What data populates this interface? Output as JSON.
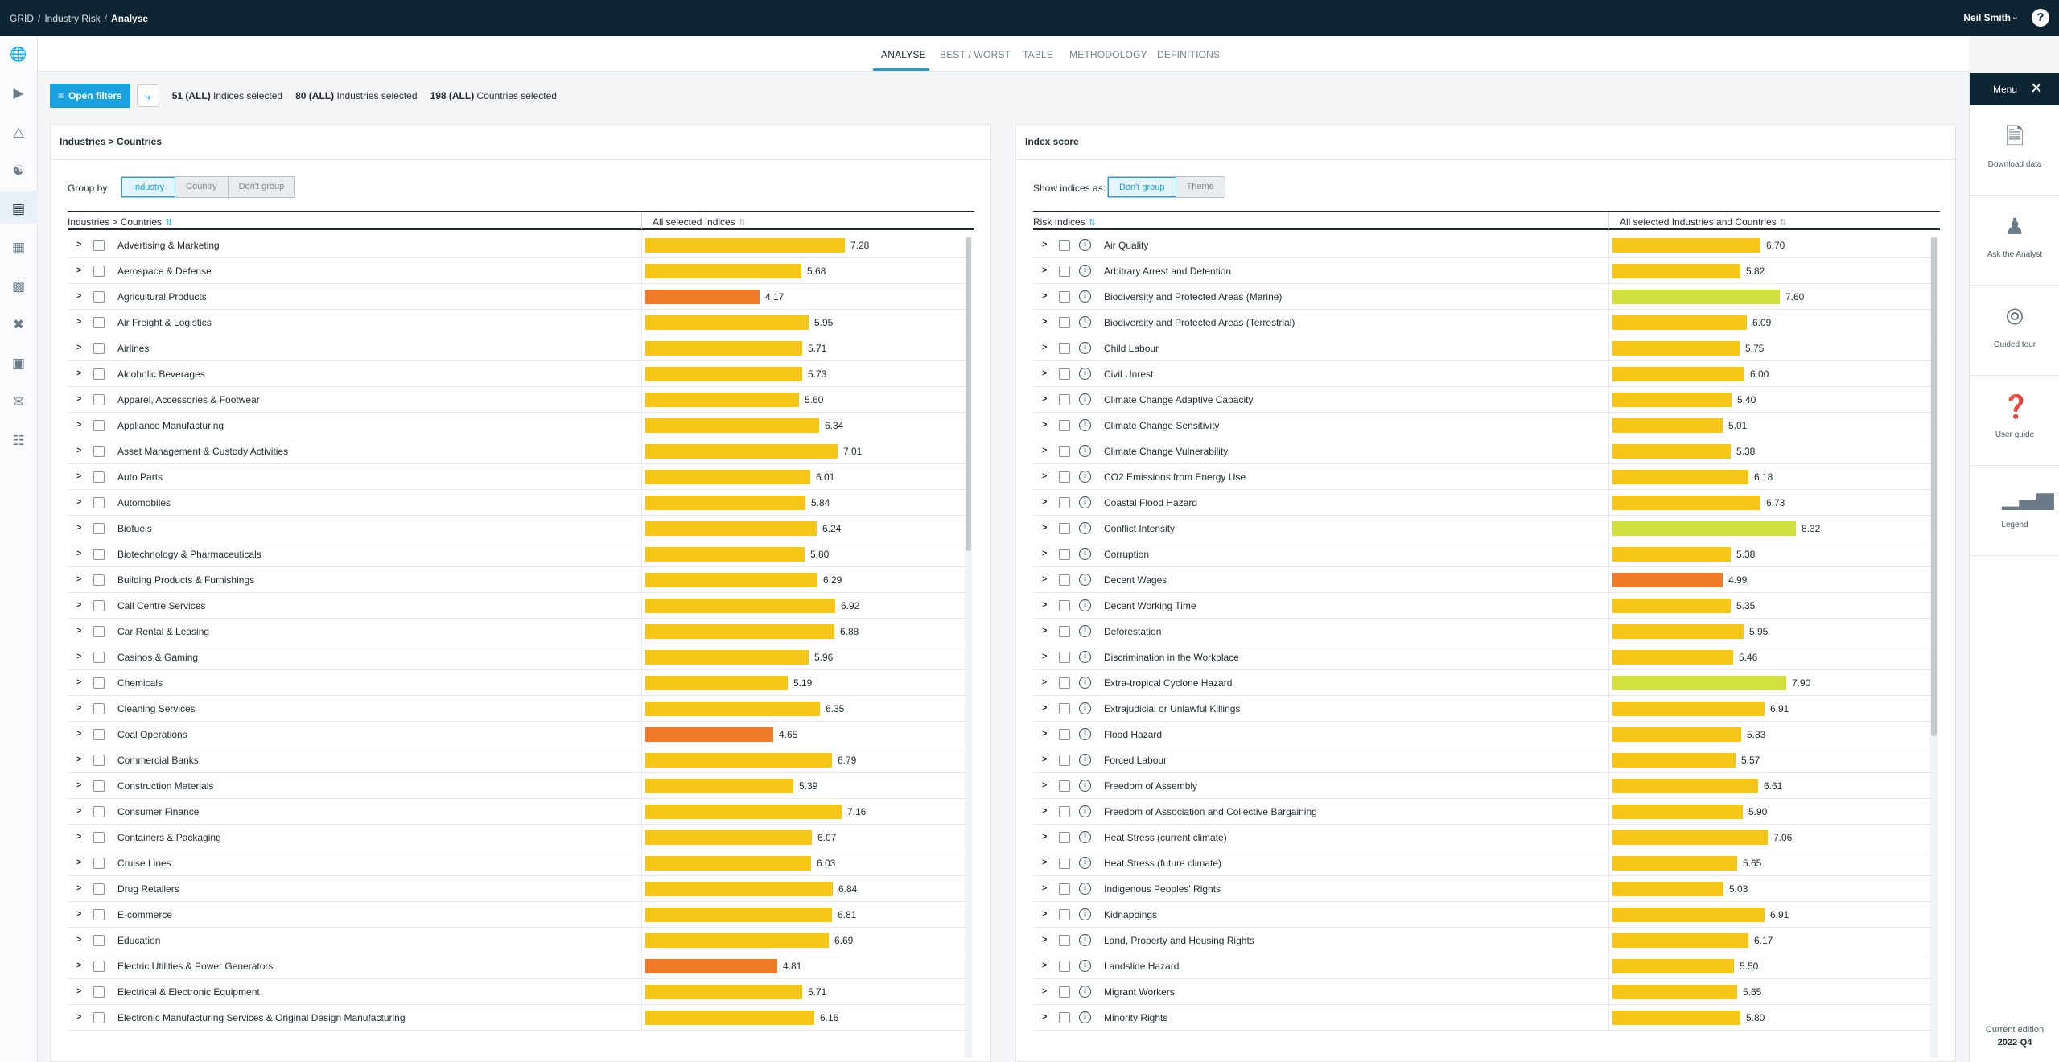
{
  "breadcrumb": [
    "GRID",
    "Industry Risk",
    "Analyse"
  ],
  "user": {
    "name": "Neil Smith"
  },
  "icons": {
    "help": "help-icon",
    "nav": [
      "globe-icon",
      "video-icon",
      "alert-triangle-icon",
      "handshake-icon",
      "chart-icon",
      "factory-icon",
      "buildings-icon",
      "tools-icon",
      "box-icon",
      "mail-icon",
      "calendar-icon"
    ]
  },
  "tabs": [
    "ANALYSE",
    "BEST / WORST",
    "TABLE",
    "METHODOLOGY",
    "DEFINITIONS"
  ],
  "filterbar": {
    "open_filters": "Open filters",
    "indices_count": "51 (ALL)",
    "indices_text": "Indices selected",
    "industries_count": "80 (ALL)",
    "industries_text": "Industries selected",
    "countries_count": "198 (ALL)",
    "countries_text": "Countries selected"
  },
  "colors": {
    "high": "#f5c518",
    "very_high": "#f07c29",
    "medium_high": "#d2e03f",
    "accent": "#1aa0dc",
    "dark": "#0d2433"
  },
  "left_panel": {
    "title": "Industries > Countries",
    "group_by_label": "Group by:",
    "group_options": [
      "Industry",
      "Country",
      "Don't group"
    ],
    "col1_header": "Industries > Countries",
    "col2_header": "All selected Indices",
    "rows": [
      {
        "label": "Advertising & Marketing",
        "value": 7.28,
        "color": "#f5c518"
      },
      {
        "label": "Aerospace & Defense",
        "value": 5.68,
        "color": "#f5c518"
      },
      {
        "label": "Agricultural Products",
        "value": 4.17,
        "color": "#f07c29"
      },
      {
        "label": "Air Freight & Logistics",
        "value": 5.95,
        "color": "#f5c518"
      },
      {
        "label": "Airlines",
        "value": 5.71,
        "color": "#f5c518"
      },
      {
        "label": "Alcoholic Beverages",
        "value": 5.73,
        "color": "#f5c518"
      },
      {
        "label": "Apparel, Accessories & Footwear",
        "value": 5.6,
        "color": "#f5c518"
      },
      {
        "label": "Appliance Manufacturing",
        "value": 6.34,
        "color": "#f5c518"
      },
      {
        "label": "Asset Management & Custody Activities",
        "value": 7.01,
        "color": "#f5c518"
      },
      {
        "label": "Auto Parts",
        "value": 6.01,
        "color": "#f5c518"
      },
      {
        "label": "Automobiles",
        "value": 5.84,
        "color": "#f5c518"
      },
      {
        "label": "Biofuels",
        "value": 6.24,
        "color": "#f5c518"
      },
      {
        "label": "Biotechnology & Pharmaceuticals",
        "value": 5.8,
        "color": "#f5c518"
      },
      {
        "label": "Building Products & Furnishings",
        "value": 6.29,
        "color": "#f5c518"
      },
      {
        "label": "Call Centre Services",
        "value": 6.92,
        "color": "#f5c518"
      },
      {
        "label": "Car Rental & Leasing",
        "value": 6.88,
        "color": "#f5c518"
      },
      {
        "label": "Casinos & Gaming",
        "value": 5.96,
        "color": "#f5c518"
      },
      {
        "label": "Chemicals",
        "value": 5.19,
        "color": "#f5c518"
      },
      {
        "label": "Cleaning Services",
        "value": 6.35,
        "color": "#f5c518"
      },
      {
        "label": "Coal Operations",
        "value": 4.65,
        "color": "#f07c29"
      },
      {
        "label": "Commercial Banks",
        "value": 6.79,
        "color": "#f5c518"
      },
      {
        "label": "Construction Materials",
        "value": 5.39,
        "color": "#f5c518"
      },
      {
        "label": "Consumer Finance",
        "value": 7.16,
        "color": "#f5c518"
      },
      {
        "label": "Containers & Packaging",
        "value": 6.07,
        "color": "#f5c518"
      },
      {
        "label": "Cruise Lines",
        "value": 6.03,
        "color": "#f5c518"
      },
      {
        "label": "Drug Retailers",
        "value": 6.84,
        "color": "#f5c518"
      },
      {
        "label": "E-commerce",
        "value": 6.81,
        "color": "#f5c518"
      },
      {
        "label": "Education",
        "value": 6.69,
        "color": "#f5c518"
      },
      {
        "label": "Electric Utilities & Power Generators",
        "value": 4.81,
        "color": "#f07c29"
      },
      {
        "label": "Electrical & Electronic Equipment",
        "value": 5.71,
        "color": "#f5c518"
      },
      {
        "label": "Electronic Manufacturing Services & Original Design Manufacturing",
        "value": 6.16,
        "color": "#f5c518"
      }
    ]
  },
  "right_panel": {
    "title": "Index score",
    "show_label": "Show indices as:",
    "show_options": [
      "Don't group",
      "Theme"
    ],
    "col1_header": "Risk Indices",
    "col2_header": "All selected Industries and Countries",
    "rows": [
      {
        "label": "Air Quality",
        "value": 6.7,
        "color": "#f5c518"
      },
      {
        "label": "Arbitrary Arrest and Detention",
        "value": 5.82,
        "color": "#f5c518"
      },
      {
        "label": "Biodiversity and Protected Areas (Marine)",
        "value": 7.6,
        "color": "#d2e03f"
      },
      {
        "label": "Biodiversity and Protected Areas (Terrestrial)",
        "value": 6.09,
        "color": "#f5c518"
      },
      {
        "label": "Child Labour",
        "value": 5.75,
        "color": "#f5c518"
      },
      {
        "label": "Civil Unrest",
        "value": 6.0,
        "color": "#f5c518"
      },
      {
        "label": "Climate Change Adaptive Capacity",
        "value": 5.4,
        "color": "#f5c518"
      },
      {
        "label": "Climate Change Sensitivity",
        "value": 5.01,
        "color": "#f5c518"
      },
      {
        "label": "Climate Change Vulnerability",
        "value": 5.38,
        "color": "#f5c518"
      },
      {
        "label": "CO2 Emissions from Energy Use",
        "value": 6.18,
        "color": "#f5c518"
      },
      {
        "label": "Coastal Flood Hazard",
        "value": 6.73,
        "color": "#f5c518"
      },
      {
        "label": "Conflict Intensity",
        "value": 8.32,
        "color": "#d2e03f"
      },
      {
        "label": "Corruption",
        "value": 5.38,
        "color": "#f5c518"
      },
      {
        "label": "Decent Wages",
        "value": 4.99,
        "color": "#f07c29"
      },
      {
        "label": "Decent Working Time",
        "value": 5.35,
        "color": "#f5c518"
      },
      {
        "label": "Deforestation",
        "value": 5.95,
        "color": "#f5c518"
      },
      {
        "label": "Discrimination in the Workplace",
        "value": 5.46,
        "color": "#f5c518"
      },
      {
        "label": "Extra-tropical Cyclone Hazard",
        "value": 7.9,
        "color": "#d2e03f"
      },
      {
        "label": "Extrajudicial or Unlawful Killings",
        "value": 6.91,
        "color": "#f5c518"
      },
      {
        "label": "Flood Hazard",
        "value": 5.83,
        "color": "#f5c518"
      },
      {
        "label": "Forced Labour",
        "value": 5.57,
        "color": "#f5c518"
      },
      {
        "label": "Freedom of Assembly",
        "value": 6.61,
        "color": "#f5c518"
      },
      {
        "label": "Freedom of Association and Collective Bargaining",
        "value": 5.9,
        "color": "#f5c518"
      },
      {
        "label": "Heat Stress (current climate)",
        "value": 7.06,
        "color": "#f5c518"
      },
      {
        "label": "Heat Stress (future climate)",
        "value": 5.65,
        "color": "#f5c518"
      },
      {
        "label": "Indigenous Peoples' Rights",
        "value": 5.03,
        "color": "#f5c518"
      },
      {
        "label": "Kidnappings",
        "value": 6.91,
        "color": "#f5c518"
      },
      {
        "label": "Land, Property and Housing Rights",
        "value": 6.17,
        "color": "#f5c518"
      },
      {
        "label": "Landslide Hazard",
        "value": 5.5,
        "color": "#f5c518"
      },
      {
        "label": "Migrant Workers",
        "value": 5.65,
        "color": "#f5c518"
      },
      {
        "label": "Minority Rights",
        "value": 5.8,
        "color": "#f5c518"
      }
    ]
  },
  "right_menu": {
    "title": "Menu",
    "items": [
      {
        "label": "Download data",
        "icon": "file-x-icon"
      },
      {
        "label": "Ask the Analyst",
        "icon": "analyst-icon"
      },
      {
        "label": "Guided tour",
        "icon": "compass-icon"
      },
      {
        "label": "User guide",
        "icon": "help-doc-icon"
      },
      {
        "label": "Legend",
        "icon": "legend-bars-icon"
      }
    ],
    "edition_label": "Current edition",
    "edition_value": "2022-Q4"
  }
}
